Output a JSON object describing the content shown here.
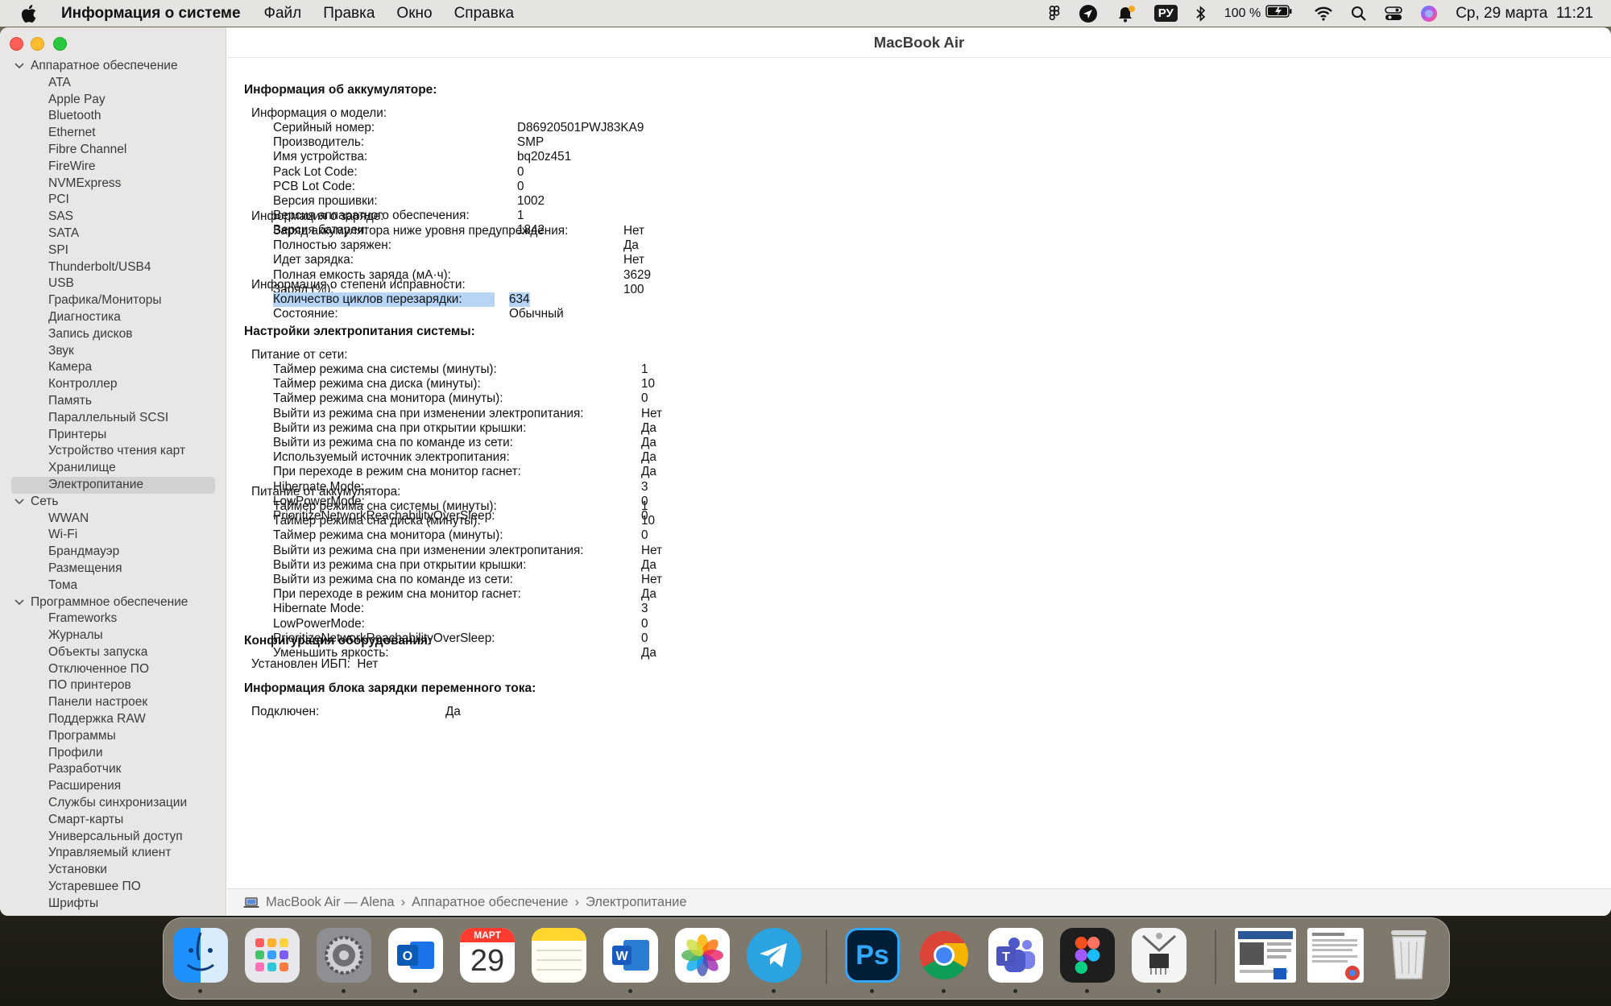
{
  "menubar": {
    "app_name": "Информация о системе",
    "menus": [
      "Файл",
      "Правка",
      "Окно",
      "Справка"
    ],
    "input_source": "РУ",
    "battery_percent": "100 %",
    "datetime": "Ср, 29 марта  11:21"
  },
  "window": {
    "title": "MacBook Air"
  },
  "sidebar": {
    "groups": [
      {
        "label": "Аппаратное обеспечение",
        "items": [
          "ATA",
          "Apple Pay",
          "Bluetooth",
          "Ethernet",
          "Fibre Channel",
          "FireWire",
          "NVMExpress",
          "PCI",
          "SAS",
          "SATA",
          "SPI",
          "Thunderbolt/USB4",
          "USB",
          "Графика/Мониторы",
          "Диагностика",
          "Запись дисков",
          "Звук",
          "Камера",
          "Контроллер",
          "Память",
          "Параллельный SCSI",
          "Принтеры",
          "Устройство чтения карт",
          "Хранилище",
          "Электропитание"
        ]
      },
      {
        "label": "Сеть",
        "items": [
          "WWAN",
          "Wi-Fi",
          "Брандмауэр",
          "Размещения",
          "Тома"
        ]
      },
      {
        "label": "Программное обеспечение",
        "items": [
          "Frameworks",
          "Журналы",
          "Объекты запуска",
          "Отключенное ПО",
          "ПО принтеров",
          "Панели настроек",
          "Поддержка RAW",
          "Программы",
          "Профили",
          "Разработчик",
          "Расширения",
          "Службы синхронизации",
          "Смарт-карты",
          "Универсальный доступ",
          "Управляемый клиент",
          "Установки",
          "Устаревшее ПО",
          "Шрифты"
        ]
      }
    ],
    "selected": "Электропитание"
  },
  "report": {
    "battery_header": "Информация об аккумуляторе:",
    "model_header": "Информация о модели:",
    "model": [
      [
        "Серийный номер:",
        "D86920501PWJ83KA9"
      ],
      [
        "Производитель:",
        "SMP"
      ],
      [
        "Имя устройства:",
        "bq20z451"
      ],
      [
        "Pack Lot Code:",
        "0"
      ],
      [
        "PCB Lot Code:",
        "0"
      ],
      [
        "Версия прошивки:",
        "1002"
      ],
      [
        "Версия аппаратного обеспечения:",
        "1"
      ],
      [
        "Версия батареи:",
        "1842"
      ]
    ],
    "charge_header": "Информация о заряде:",
    "charge": [
      [
        "Заряд аккумулятора ниже уровня предупреждения:",
        "Нет"
      ],
      [
        "Полностью заряжен:",
        "Да"
      ],
      [
        "Идет зарядка:",
        "Нет"
      ],
      [
        "Полная емкость заряда (мА·ч):",
        "3629"
      ],
      [
        "Заряд (%):",
        "100"
      ]
    ],
    "health_header": "Информация о степени исправности:",
    "health": [
      [
        "Количество циклов перезарядки:",
        "634"
      ],
      [
        "Состояние:",
        "Обычный"
      ]
    ],
    "power_header": "Настройки электропитания системы:",
    "ac_header": "Питание от сети:",
    "ac": [
      [
        "Таймер режима сна системы (минуты):",
        "1"
      ],
      [
        "Таймер режима сна диска (минуты):",
        "10"
      ],
      [
        "Таймер режима сна монитора (минуты):",
        "0"
      ],
      [
        "Выйти из режима сна при изменении электропитания:",
        "Нет"
      ],
      [
        "Выйти из режима сна при открытии крышки:",
        "Да"
      ],
      [
        "Выйти из режима сна по команде из сети:",
        "Да"
      ],
      [
        "Используемый источник электропитания:",
        "Да"
      ],
      [
        "При переходе в режим сна монитор гаснет:",
        "Да"
      ],
      [
        "Hibernate Mode:",
        "3"
      ],
      [
        "LowPowerMode:",
        "0"
      ],
      [
        "PrioritizeNetworkReachabilityOverSleep:",
        "0"
      ]
    ],
    "batt_header": "Питание от аккумулятора:",
    "batt": [
      [
        "Таймер режима сна системы (минуты):",
        "1"
      ],
      [
        "Таймер режима сна диска (минуты):",
        "10"
      ],
      [
        "Таймер режима сна монитора (минуты):",
        "0"
      ],
      [
        "Выйти из режима сна при изменении электропитания:",
        "Нет"
      ],
      [
        "Выйти из режима сна при открытии крышки:",
        "Да"
      ],
      [
        "Выйти из режима сна по команде из сети:",
        "Нет"
      ],
      [
        "При переходе в режим сна монитор гаснет:",
        "Да"
      ],
      [
        "Hibernate Mode:",
        "3"
      ],
      [
        "LowPowerMode:",
        "0"
      ],
      [
        "PrioritizeNetworkReachabilityOverSleep:",
        "0"
      ],
      [
        "Уменьшить яркость:",
        "Да"
      ]
    ],
    "hw_header": "Конфигурация оборудования:",
    "ups_label": "Установлен ИБП:",
    "ups_value": "Нет",
    "ac_charger_header": "Информация блока зарядки переменного тока:",
    "connected_label": "Подключен:",
    "connected_value": "Да"
  },
  "statusbar": {
    "path": [
      "MacBook Air — Alena",
      "Аппаратное обеспечение",
      "Электропитание"
    ],
    "separator": "›"
  },
  "dock": {
    "calendar_month": "МАРТ",
    "calendar_day": "29",
    "apps": [
      "finder-icon",
      "launchpad-icon",
      "system-settings-icon",
      "outlook-icon",
      "calendar-icon",
      "notes-icon",
      "word-icon",
      "photos-icon",
      "telegram-icon",
      "photoshop-icon",
      "chrome-icon",
      "teams-icon",
      "figma-icon",
      "system-information-icon",
      "document-thumbnail-icon",
      "document-thumbnail-icon",
      "trash-icon"
    ]
  }
}
